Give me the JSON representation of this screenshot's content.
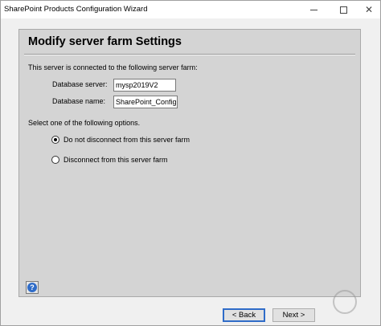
{
  "window": {
    "title": "SharePoint Products Configuration Wizard",
    "minimize_icon": "minimize-icon",
    "maximize_icon": "maximize-icon",
    "close_icon": "close-icon"
  },
  "page": {
    "heading": "Modify server farm Settings",
    "connected_text": "This server is connected to the following server farm:",
    "database_server_label": "Database server:",
    "database_server_value": "mysp2019V2",
    "database_name_label": "Database name:",
    "database_name_value": "SharePoint_ConfigD",
    "options_prompt": "Select one of the following options.",
    "options": [
      {
        "label": "Do not disconnect from this server farm",
        "checked": true
      },
      {
        "label": "Disconnect from this server farm",
        "checked": false
      }
    ]
  },
  "footer": {
    "help_icon": "help-icon",
    "back_label": "< Back",
    "next_label": "Next >"
  },
  "colors": {
    "accent": "#2f6cc8",
    "panel": "#d4d4d4",
    "window": "#f0f0f0"
  }
}
